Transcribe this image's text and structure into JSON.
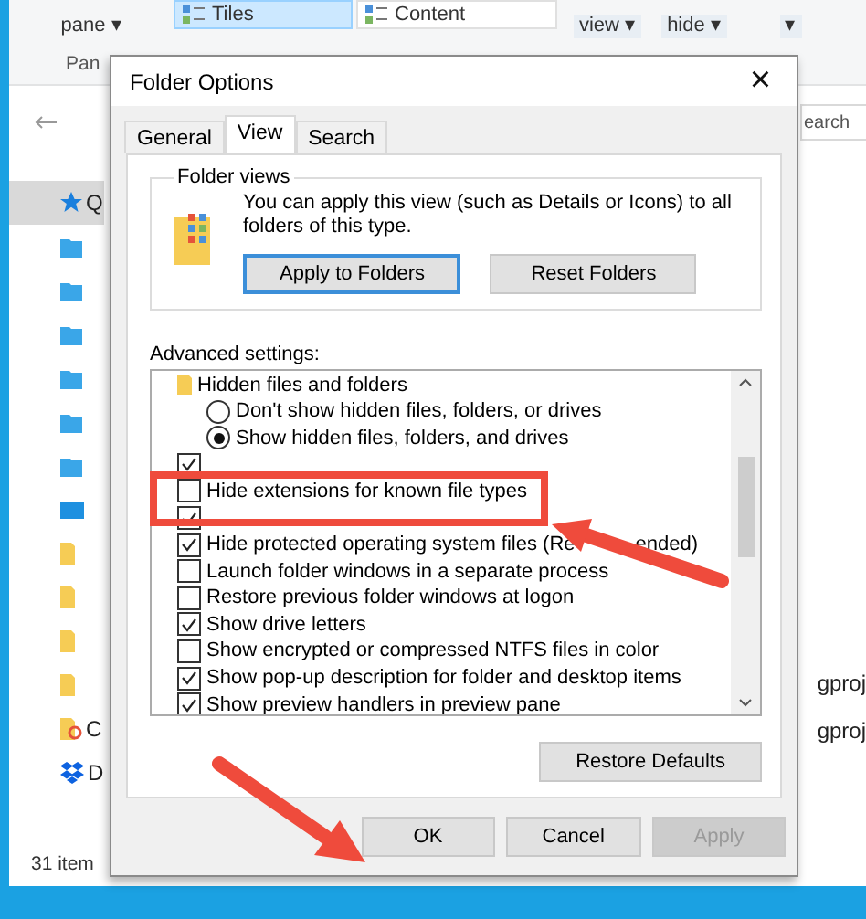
{
  "ribbon": {
    "groups": [
      {
        "kind": "nav",
        "lines": [
          "pane ▾"
        ]
      },
      {
        "kind": "layout",
        "items": [
          "Tiles",
          "Content"
        ]
      },
      {
        "kind": "menu",
        "lines": [
          "view ▾"
        ]
      },
      {
        "kind": "menu",
        "lines": [
          "hide ▾"
        ]
      },
      {
        "kind": "menu",
        "lines": [
          "▾"
        ]
      }
    ],
    "group_label": "Pan"
  },
  "search": {
    "placeholder": "earch"
  },
  "sidebar": {
    "items": [
      {
        "kind": "star",
        "label": "Q",
        "selected": true
      },
      {
        "kind": "blue-folder",
        "selected": false
      },
      {
        "kind": "blue-folder",
        "selected": false
      },
      {
        "kind": "blue-folder",
        "selected": false
      },
      {
        "kind": "blue-folder",
        "selected": false
      },
      {
        "kind": "blue-folder",
        "selected": false
      },
      {
        "kind": "blue-folder",
        "selected": false
      },
      {
        "kind": "drive",
        "selected": false
      },
      {
        "kind": "folder",
        "selected": false
      },
      {
        "kind": "folder",
        "selected": false
      },
      {
        "kind": "folder",
        "selected": false
      },
      {
        "kind": "folder",
        "selected": false
      },
      {
        "kind": "cloud-folder",
        "label": "C",
        "selected": false
      },
      {
        "kind": "dropbox",
        "label": "D",
        "selected": false
      }
    ]
  },
  "files": [
    "gproj",
    "gproj"
  ],
  "status_bar": "31 item",
  "dialog": {
    "title": "Folder Options",
    "close": "×",
    "tabs": [
      {
        "label": "General",
        "selected": false
      },
      {
        "label": "View",
        "selected": true
      },
      {
        "label": "Search",
        "selected": false
      }
    ],
    "folder_views": {
      "title": "Folder views",
      "text": "You can apply this view (such as Details or Icons) to all folders of this type.",
      "buttons": [
        {
          "label": "Apply to Folders",
          "focused": true
        },
        {
          "label": "Reset Folders",
          "focused": false
        }
      ]
    },
    "advanced_label": "Advanced settings:",
    "settings": [
      {
        "kind": "group",
        "label": "Hidden files and folders"
      },
      {
        "kind": "radio",
        "label": "Don't show hidden files, folders, or drives",
        "selected": false
      },
      {
        "kind": "radio",
        "label": "Show hidden files, folders, and drives",
        "selected": true
      },
      {
        "kind": "check",
        "checked": true
      },
      {
        "kind": "check",
        "label": "Hide extensions for known file types",
        "checked": false
      },
      {
        "kind": "check",
        "checked": true
      },
      {
        "kind": "check",
        "label": "Hide protected operating system files (Re",
        "label_end": "ended)",
        "checked": true
      },
      {
        "kind": "check",
        "label": "Launch folder windows in a separate process",
        "checked": false
      },
      {
        "kind": "check",
        "label": "Restore previous folder windows at logon",
        "checked": false
      },
      {
        "kind": "check",
        "label": "Show drive letters",
        "checked": true
      },
      {
        "kind": "check",
        "label": "Show encrypted or compressed NTFS files in color",
        "checked": false
      },
      {
        "kind": "check",
        "label": "Show pop-up description for folder and desktop items",
        "checked": true
      },
      {
        "kind": "check",
        "label": "Show preview handlers in preview pane",
        "checked": true
      }
    ],
    "restore_button": "Restore Defaults",
    "buttons": [
      {
        "label": "OK",
        "disabled": false
      },
      {
        "label": "Cancel",
        "disabled": false
      },
      {
        "label": "Apply",
        "disabled": true
      }
    ]
  }
}
